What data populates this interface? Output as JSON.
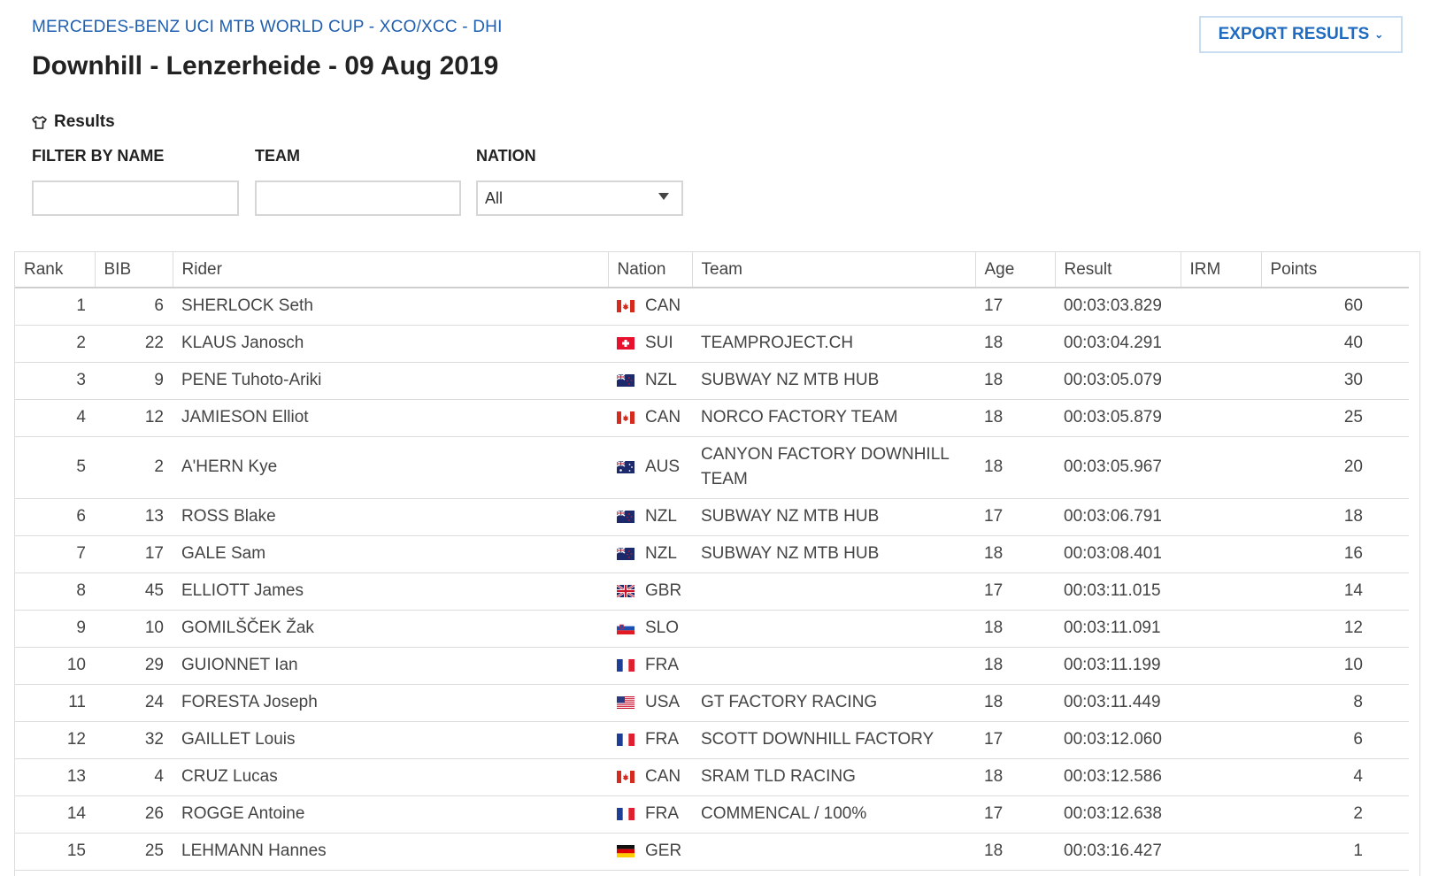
{
  "breadcrumb": "MERCEDES-BENZ UCI MTB WORLD CUP - XCO/XCC - DHI",
  "title": "Downhill - Lenzerheide - 09 Aug 2019",
  "export_label": "EXPORT RESULTS",
  "results_heading": "Results",
  "filters": {
    "name_label": "FILTER BY NAME",
    "team_label": "TEAM",
    "nation_label": "NATION",
    "name_value": "",
    "team_value": "",
    "nation_value": "All"
  },
  "columns": [
    "Rank",
    "BIB",
    "Rider",
    "Nation",
    "Team",
    "Age",
    "Result",
    "IRM",
    "Points"
  ],
  "rows": [
    {
      "rank": "1",
      "bib": "6",
      "rider": "SHERLOCK Seth",
      "nation": "CAN",
      "team": "",
      "age": "17",
      "result": "00:03:03.829",
      "irm": "",
      "points": "60"
    },
    {
      "rank": "2",
      "bib": "22",
      "rider": "KLAUS Janosch",
      "nation": "SUI",
      "team": "TEAMPROJECT.CH",
      "age": "18",
      "result": "00:03:04.291",
      "irm": "",
      "points": "40"
    },
    {
      "rank": "3",
      "bib": "9",
      "rider": "PENE Tuhoto-Ariki",
      "nation": "NZL",
      "team": "SUBWAY NZ MTB HUB",
      "age": "18",
      "result": "00:03:05.079",
      "irm": "",
      "points": "30"
    },
    {
      "rank": "4",
      "bib": "12",
      "rider": "JAMIESON Elliot",
      "nation": "CAN",
      "team": "NORCO FACTORY TEAM",
      "age": "18",
      "result": "00:03:05.879",
      "irm": "",
      "points": "25"
    },
    {
      "rank": "5",
      "bib": "2",
      "rider": "A'HERN Kye",
      "nation": "AUS",
      "team": "CANYON FACTORY DOWNHILL TEAM",
      "age": "18",
      "result": "00:03:05.967",
      "irm": "",
      "points": "20"
    },
    {
      "rank": "6",
      "bib": "13",
      "rider": "ROSS Blake",
      "nation": "NZL",
      "team": "SUBWAY NZ MTB HUB",
      "age": "17",
      "result": "00:03:06.791",
      "irm": "",
      "points": "18"
    },
    {
      "rank": "7",
      "bib": "17",
      "rider": "GALE Sam",
      "nation": "NZL",
      "team": "SUBWAY NZ MTB HUB",
      "age": "18",
      "result": "00:03:08.401",
      "irm": "",
      "points": "16"
    },
    {
      "rank": "8",
      "bib": "45",
      "rider": "ELLIOTT James",
      "nation": "GBR",
      "team": "",
      "age": "17",
      "result": "00:03:11.015",
      "irm": "",
      "points": "14"
    },
    {
      "rank": "9",
      "bib": "10",
      "rider": "GOMILŠČEK Žak",
      "nation": "SLO",
      "team": "",
      "age": "18",
      "result": "00:03:11.091",
      "irm": "",
      "points": "12"
    },
    {
      "rank": "10",
      "bib": "29",
      "rider": "GUIONNET Ian",
      "nation": "FRA",
      "team": "",
      "age": "18",
      "result": "00:03:11.199",
      "irm": "",
      "points": "10"
    },
    {
      "rank": "11",
      "bib": "24",
      "rider": "FORESTA Joseph",
      "nation": "USA",
      "team": "GT FACTORY RACING",
      "age": "18",
      "result": "00:03:11.449",
      "irm": "",
      "points": "8"
    },
    {
      "rank": "12",
      "bib": "32",
      "rider": "GAILLET Louis",
      "nation": "FRA",
      "team": "SCOTT DOWNHILL FACTORY",
      "age": "17",
      "result": "00:03:12.060",
      "irm": "",
      "points": "6"
    },
    {
      "rank": "13",
      "bib": "4",
      "rider": "CRUZ Lucas",
      "nation": "CAN",
      "team": "SRAM TLD RACING",
      "age": "18",
      "result": "00:03:12.586",
      "irm": "",
      "points": "4"
    },
    {
      "rank": "14",
      "bib": "26",
      "rider": "ROGGE Antoine",
      "nation": "FRA",
      "team": "COMMENCAL / 100%",
      "age": "17",
      "result": "00:03:12.638",
      "irm": "",
      "points": "2"
    },
    {
      "rank": "15",
      "bib": "25",
      "rider": "LEHMANN Hannes",
      "nation": "GER",
      "team": "",
      "age": "18",
      "result": "00:03:16.427",
      "irm": "",
      "points": "1"
    }
  ],
  "colors": {
    "link_blue": "#1f5fb0",
    "border": "#dcdcdc"
  }
}
